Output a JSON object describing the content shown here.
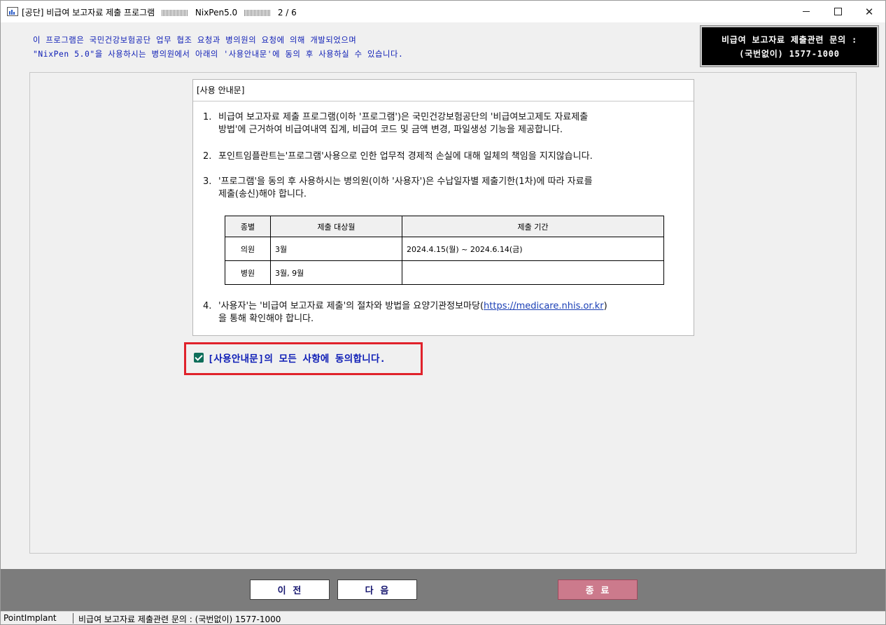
{
  "window": {
    "title_prefix": "[공단] 비급여 보고자료 제출 프로그램",
    "title_app": "NixPen5.0",
    "title_step": "2 / 6"
  },
  "intro": {
    "line1": "이 프로그램은 국민건강보험공단 업무 협조 요청과 병의원의 요청에 의해 개발되었으며",
    "line2": "\"NixPen 5.0\"을 사용하시는 병의원에서 아래의 '사용안내문'에 동의 후 사용하실 수 있습니다."
  },
  "contact": {
    "line1": "비급여 보고자료 제출관련 문의 :",
    "line2": "(국번없이) 1577-1000"
  },
  "notice": {
    "header": "[사용 안내문]",
    "item1": {
      "num": "1.",
      "line1": "비급여 보고자료 제출 프로그램(이하 '프로그램')은 국민건강보험공단의 '비급여보고제도 자료제출",
      "line2": "방법'에 근거하여 비급여내역 집계, 비급여 코드 및 금액 변경, 파일생성 기능을 제공합니다."
    },
    "item2": {
      "num": "2.",
      "line1": "포인트임플란트는'프로그램'사용으로 인한 업무적 경제적 손실에 대해 일체의 책임을 지지않습니다."
    },
    "item3": {
      "num": "3.",
      "line1": "'프로그램'을 동의 후 사용하시는 병의원(이하 '사용자')은 수납일자별 제출기한(1차)에 따라 자료를",
      "line2": "제출(송신)해야 합니다."
    },
    "table": {
      "headers": [
        "종별",
        "제출 대상월",
        "제출 기간"
      ],
      "rows": [
        [
          "의원",
          "3월",
          "2024.4.15(월) ~ 2024.6.14(금)"
        ],
        [
          "병원",
          "3월, 9월",
          ""
        ]
      ]
    },
    "item4": {
      "num": "4.",
      "line1_pre": "'사용자'는 '비급여 보고자료 제출'의 절차와 방법을 요양기관정보마당(",
      "link": "https://medicare.nhis.or.kr",
      "line1_post": ")",
      "line2": "을 통해 확인해야 합니다."
    }
  },
  "agree": {
    "checked": true,
    "label": "[사용안내문]의 모든 사항에 동의합니다."
  },
  "buttons": {
    "prev": "이 전",
    "next": "다 음",
    "exit": "종 료"
  },
  "status": {
    "left": "PointImplant",
    "right": "비급여 보고자료 제출관련 문의 : (국번없이) 1577-1000"
  },
  "colors": {
    "intro_text": "#0b1bb5",
    "agree_border": "#e0222b",
    "exit_button": "#cc7a8c",
    "bottom_bar": "#7c7c7c"
  }
}
